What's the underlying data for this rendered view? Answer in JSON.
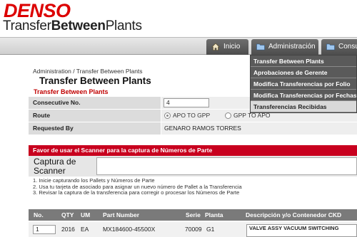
{
  "brand": {
    "logo": "DENSO",
    "app_title_prefix": "Transfer",
    "app_title_bold": "Between",
    "app_title_suffix": "Plants",
    "logo_color": "#dc0000"
  },
  "nav": {
    "tabs": [
      {
        "label": "Inicio",
        "icon": "home-icon"
      },
      {
        "label": "Administración",
        "icon": "folder-icon"
      },
      {
        "label": "Consulta",
        "icon": "folder-icon"
      }
    ]
  },
  "dropdown": {
    "items": [
      {
        "label": "Transfer Between Plants",
        "active": false
      },
      {
        "label": "Aprobaciones de Gerente",
        "active": false
      },
      {
        "label": "Modifica Transferencias por Folio",
        "active": false
      },
      {
        "label": "Modifica Transferencias por Fechas",
        "active": false
      },
      {
        "label": "Transferencias Recibidas",
        "active": true
      }
    ]
  },
  "breadcrumb": "Administration / Transfer Between Plants",
  "page_title": "Transfer Between Plants",
  "subtitle": "Transfer Between Plants",
  "form": {
    "consecutive_label": "Consecutive No.",
    "consecutive_value": "4",
    "route_label": "Route",
    "route_options": [
      {
        "label": "APO TO GPP",
        "selected": true
      },
      {
        "label": "GPP TO APO",
        "selected": false
      }
    ],
    "requested_label": "Requested By",
    "requested_value": "GENARO RAMOS TORRES"
  },
  "scanner": {
    "banner": "Favor de usar el Scanner para la captura de Números de Parte",
    "label_line1": "Captura de",
    "label_line2": "Scanner",
    "input_value": "",
    "banner_color": "#c8001e"
  },
  "instructions": [
    "1. Inicie capturando los Pallets y Números de Parte",
    "2. Usa tu tarjeta de asociado para asignar un nuevo número de Pallet a la Transferencia",
    "3. Revisar la captura de la transferencia para corregir o procesar los Números de Parte"
  ],
  "table": {
    "headers": [
      "No.",
      "QTY",
      "UM",
      "Part Number",
      "Serie",
      "Planta",
      "Descripción y/o Contenedor CKD"
    ],
    "rows": [
      {
        "no": "1",
        "qty": "2016",
        "um": "EA",
        "part_number": "MX184600-45500X",
        "serie": "70009",
        "planta": "G1",
        "description": "VALVE ASSY VACUUM SWITCHING"
      }
    ]
  }
}
